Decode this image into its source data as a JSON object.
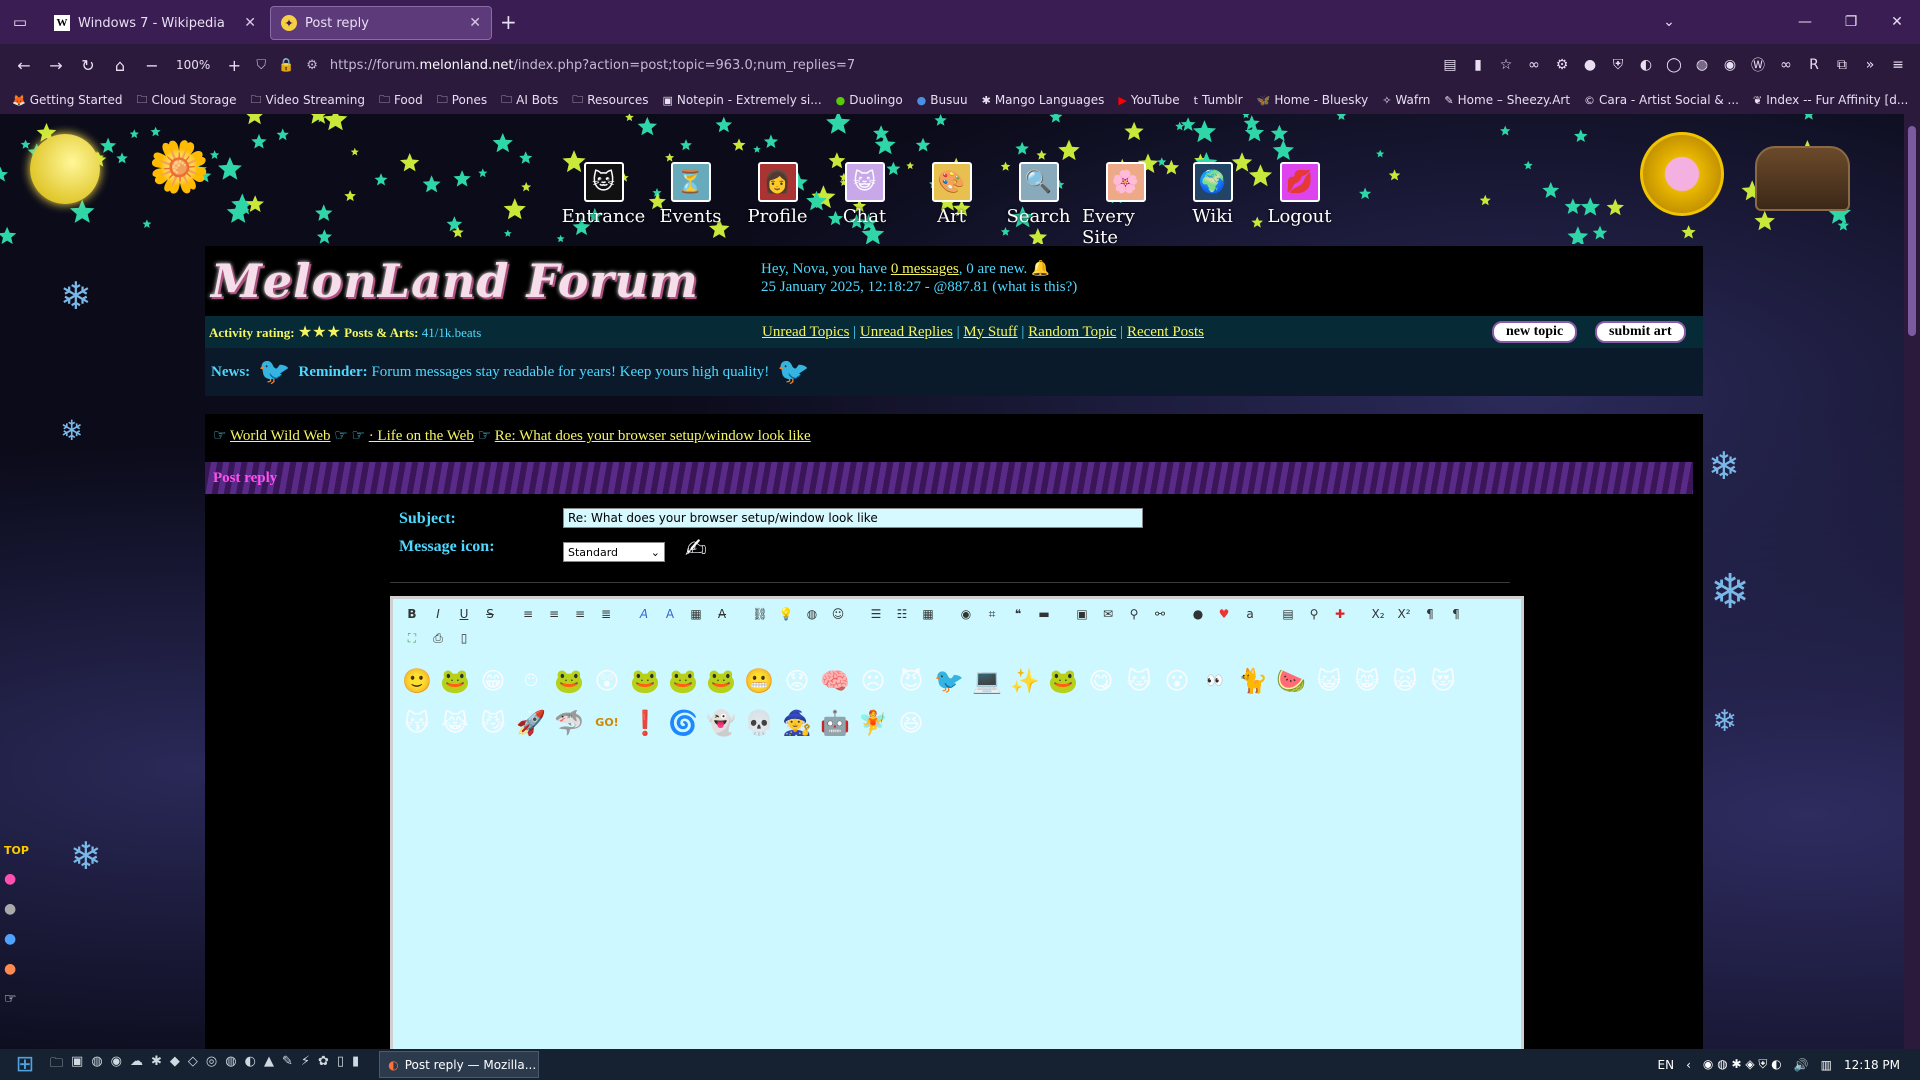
{
  "browser": {
    "tabs": [
      {
        "title": "Windows 7 - Wikipedia",
        "favicon": "wikipedia-icon"
      },
      {
        "title": "Post reply",
        "favicon": "melonland-icon"
      }
    ],
    "zoom": "100%",
    "url_prefix": "https://forum.",
    "url_domain": "melonland.net",
    "url_rest": "/index.php?action=post;topic=963.0;num_replies=7",
    "bookmarks": [
      "Getting Started",
      "Cloud Storage",
      "Video Streaming",
      "Food",
      "Pones",
      "AI Bots",
      "Resources",
      "Notepin - Extremely si...",
      "Duolingo",
      "Busuu",
      "Mango Languages",
      "YouTube",
      "Tumblr",
      "Home - Bluesky",
      "Wafrn",
      "Home – Sheezy.Art",
      "Cara - Artist Social & ...",
      "Index -- Fur Affinity [d..."
    ]
  },
  "site_nav": [
    "Entrance",
    "Events",
    "Profile",
    "Chat",
    "Art",
    "Search",
    "Every Site",
    "Wiki",
    "Logout"
  ],
  "header": {
    "logo": "MelonLand Forum",
    "greeting_pre": "Hey, Nova, you have ",
    "messages_link": "0 messages",
    "greeting_post": ", 0 are new.",
    "datetime": "25 January 2025, 12:18:27 - @887.81 (what is this?)"
  },
  "info": {
    "activity_label": "Activity rating:",
    "posts_label": "Posts & Arts:",
    "posts_value": "41/1k.beats",
    "links": [
      "Unread Topics",
      "Unread Replies",
      "My Stuff",
      "Random Topic",
      "Recent Posts"
    ],
    "new_topic": "new topic",
    "submit_art": "submit art"
  },
  "news": {
    "label": "News:",
    "reminder_label": "Reminder:",
    "text": "Forum messages stay readable for years! Keep yours high quality!"
  },
  "breadcrumb": [
    "World Wild Web",
    "· Life on the Web",
    "Re: What does your browser setup/window look like"
  ],
  "form": {
    "section_title": "Post reply",
    "subject_label": "Subject:",
    "subject_value": "Re: What does your browser setup/window look like",
    "icon_label": "Message icon:",
    "icon_value": "Standard"
  },
  "taskbar": {
    "window_title": "Post reply — Mozilla...",
    "lang": "EN",
    "time": "12:18 PM"
  }
}
